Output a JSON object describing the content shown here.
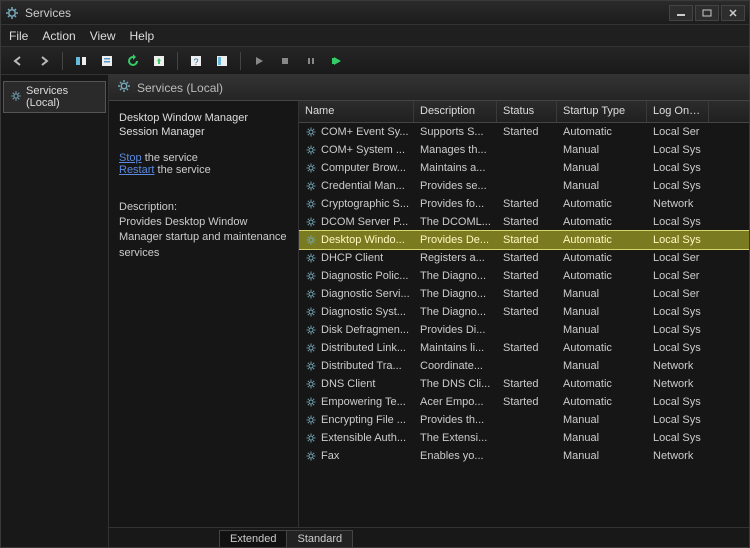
{
  "window": {
    "title": "Services"
  },
  "menu": {
    "file": "File",
    "action": "Action",
    "view": "View",
    "help": "Help"
  },
  "nav": {
    "root": "Services (Local)"
  },
  "content": {
    "heading": "Services (Local)"
  },
  "detail": {
    "title": "Desktop Window Manager Session Manager",
    "stop_prefix": "Stop",
    "stop_suffix": " the service",
    "restart_prefix": "Restart",
    "restart_suffix": " the service",
    "desc_label": "Description:",
    "desc_text": "Provides Desktop Window Manager startup and maintenance services"
  },
  "columns": {
    "name": "Name",
    "description": "Description",
    "status": "Status",
    "startup": "Startup Type",
    "logon": "Log On As"
  },
  "tabs": {
    "extended": "Extended",
    "standard": "Standard"
  },
  "services": [
    {
      "name": "COM+ Event Sy...",
      "desc": "Supports S...",
      "status": "Started",
      "startup": "Automatic",
      "logon": "Local Ser",
      "sel": false
    },
    {
      "name": "COM+ System ...",
      "desc": "Manages th...",
      "status": "",
      "startup": "Manual",
      "logon": "Local Sys",
      "sel": false
    },
    {
      "name": "Computer Brow...",
      "desc": "Maintains a...",
      "status": "",
      "startup": "Manual",
      "logon": "Local Sys",
      "sel": false
    },
    {
      "name": "Credential Man...",
      "desc": "Provides se...",
      "status": "",
      "startup": "Manual",
      "logon": "Local Sys",
      "sel": false
    },
    {
      "name": "Cryptographic S...",
      "desc": "Provides fo...",
      "status": "Started",
      "startup": "Automatic",
      "logon": "Network",
      "sel": false
    },
    {
      "name": "DCOM Server P...",
      "desc": "The DCOML...",
      "status": "Started",
      "startup": "Automatic",
      "logon": "Local Sys",
      "sel": false
    },
    {
      "name": "Desktop Windo...",
      "desc": "Provides De...",
      "status": "Started",
      "startup": "Automatic",
      "logon": "Local Sys",
      "sel": true
    },
    {
      "name": "DHCP Client",
      "desc": "Registers a...",
      "status": "Started",
      "startup": "Automatic",
      "logon": "Local Ser",
      "sel": false
    },
    {
      "name": "Diagnostic Polic...",
      "desc": "The Diagno...",
      "status": "Started",
      "startup": "Automatic",
      "logon": "Local Ser",
      "sel": false
    },
    {
      "name": "Diagnostic Servi...",
      "desc": "The Diagno...",
      "status": "Started",
      "startup": "Manual",
      "logon": "Local Ser",
      "sel": false
    },
    {
      "name": "Diagnostic Syst...",
      "desc": "The Diagno...",
      "status": "Started",
      "startup": "Manual",
      "logon": "Local Sys",
      "sel": false
    },
    {
      "name": "Disk Defragmen...",
      "desc": "Provides Di...",
      "status": "",
      "startup": "Manual",
      "logon": "Local Sys",
      "sel": false
    },
    {
      "name": "Distributed Link...",
      "desc": "Maintains li...",
      "status": "Started",
      "startup": "Automatic",
      "logon": "Local Sys",
      "sel": false
    },
    {
      "name": "Distributed Tra...",
      "desc": "Coordinate...",
      "status": "",
      "startup": "Manual",
      "logon": "Network",
      "sel": false
    },
    {
      "name": "DNS Client",
      "desc": "The DNS Cli...",
      "status": "Started",
      "startup": "Automatic",
      "logon": "Network",
      "sel": false
    },
    {
      "name": "Empowering Te...",
      "desc": "Acer Empo...",
      "status": "Started",
      "startup": "Automatic",
      "logon": "Local Sys",
      "sel": false
    },
    {
      "name": "Encrypting File ...",
      "desc": "Provides th...",
      "status": "",
      "startup": "Manual",
      "logon": "Local Sys",
      "sel": false
    },
    {
      "name": "Extensible Auth...",
      "desc": "The Extensi...",
      "status": "",
      "startup": "Manual",
      "logon": "Local Sys",
      "sel": false
    },
    {
      "name": "Fax",
      "desc": "Enables yo...",
      "status": "",
      "startup": "Manual",
      "logon": "Network",
      "sel": false
    }
  ]
}
